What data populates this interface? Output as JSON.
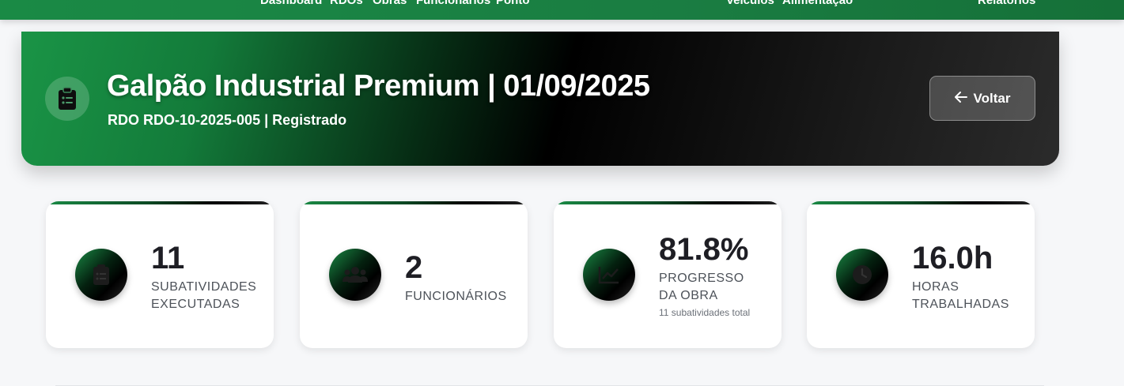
{
  "nav": {
    "links": [
      "Dashboard",
      "RDOs",
      "Obras",
      "Funcionários",
      "Ponto",
      "Veículos",
      "Alimentação",
      "Relatórios"
    ]
  },
  "header": {
    "title": "Galpão Industrial Premium | 01/09/2025",
    "subtitle": "RDO RDO-10-2025-005 | Registrado",
    "back_label": "Voltar"
  },
  "stats": [
    {
      "value": "11",
      "label": "SUBATIVIDADES EXECUTADAS",
      "icon": "clipboard-list-icon"
    },
    {
      "value": "2",
      "label": "FUNCIONÁRIOS",
      "icon": "users-icon"
    },
    {
      "value": "81.8%",
      "label": "PROGRESSO DA OBRA",
      "extra": "11 subatividades total",
      "icon": "chart-line-icon"
    },
    {
      "value": "16.0h",
      "label": "HORAS TRABALHADAS",
      "icon": "clock-icon"
    }
  ],
  "colors": {
    "brand_green": "#1a8a45",
    "dark": "#000000",
    "text_dark": "#1e1e24",
    "text_muted": "#4d5259"
  }
}
